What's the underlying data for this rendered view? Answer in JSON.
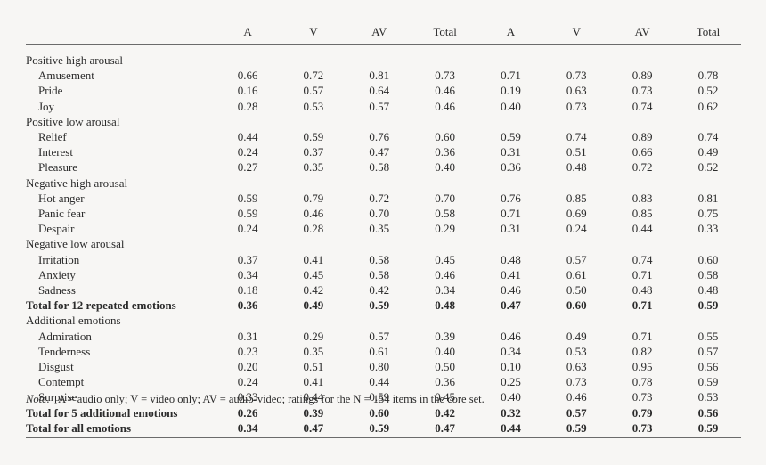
{
  "table": {
    "label_column_header": "",
    "column_headers": [
      "A",
      "V",
      "AV",
      "Total",
      "A",
      "V",
      "AV",
      "Total"
    ],
    "rows": [
      {
        "type": "group",
        "label": "Positive high arousal",
        "values": [
          "",
          "",
          "",
          "",
          "",
          "",
          "",
          ""
        ]
      },
      {
        "type": "emotion",
        "label": "Amusement",
        "values": [
          "0.66",
          "0.72",
          "0.81",
          "0.73",
          "0.71",
          "0.73",
          "0.89",
          "0.78"
        ]
      },
      {
        "type": "emotion",
        "label": "Pride",
        "values": [
          "0.16",
          "0.57",
          "0.64",
          "0.46",
          "0.19",
          "0.63",
          "0.73",
          "0.52"
        ]
      },
      {
        "type": "emotion",
        "label": "Joy",
        "values": [
          "0.28",
          "0.53",
          "0.57",
          "0.46",
          "0.40",
          "0.73",
          "0.74",
          "0.62"
        ]
      },
      {
        "type": "group",
        "label": "Positive low arousal",
        "values": [
          "",
          "",
          "",
          "",
          "",
          "",
          "",
          ""
        ]
      },
      {
        "type": "emotion",
        "label": "Relief",
        "values": [
          "0.44",
          "0.59",
          "0.76",
          "0.60",
          "0.59",
          "0.74",
          "0.89",
          "0.74"
        ]
      },
      {
        "type": "emotion",
        "label": "Interest",
        "values": [
          "0.24",
          "0.37",
          "0.47",
          "0.36",
          "0.31",
          "0.51",
          "0.66",
          "0.49"
        ]
      },
      {
        "type": "emotion",
        "label": "Pleasure",
        "values": [
          "0.27",
          "0.35",
          "0.58",
          "0.40",
          "0.36",
          "0.48",
          "0.72",
          "0.52"
        ]
      },
      {
        "type": "group",
        "label": "Negative high arousal",
        "values": [
          "",
          "",
          "",
          "",
          "",
          "",
          "",
          ""
        ]
      },
      {
        "type": "emotion",
        "label": "Hot anger",
        "values": [
          "0.59",
          "0.79",
          "0.72",
          "0.70",
          "0.76",
          "0.85",
          "0.83",
          "0.81"
        ]
      },
      {
        "type": "emotion",
        "label": "Panic fear",
        "values": [
          "0.59",
          "0.46",
          "0.70",
          "0.58",
          "0.71",
          "0.69",
          "0.85",
          "0.75"
        ]
      },
      {
        "type": "emotion",
        "label": "Despair",
        "values": [
          "0.24",
          "0.28",
          "0.35",
          "0.29",
          "0.31",
          "0.24",
          "0.44",
          "0.33"
        ]
      },
      {
        "type": "group",
        "label": "Negative low arousal",
        "values": [
          "",
          "",
          "",
          "",
          "",
          "",
          "",
          ""
        ]
      },
      {
        "type": "emotion",
        "label": "Irritation",
        "values": [
          "0.37",
          "0.41",
          "0.58",
          "0.45",
          "0.48",
          "0.57",
          "0.74",
          "0.60"
        ]
      },
      {
        "type": "emotion",
        "label": "Anxiety",
        "values": [
          "0.34",
          "0.45",
          "0.58",
          "0.46",
          "0.41",
          "0.61",
          "0.71",
          "0.58"
        ]
      },
      {
        "type": "emotion",
        "label": "Sadness",
        "values": [
          "0.18",
          "0.42",
          "0.42",
          "0.34",
          "0.46",
          "0.50",
          "0.48",
          "0.48"
        ]
      },
      {
        "type": "total",
        "label": "Total for 12 repeated emotions",
        "values": [
          "0.36",
          "0.49",
          "0.59",
          "0.48",
          "0.47",
          "0.60",
          "0.71",
          "0.59"
        ]
      },
      {
        "type": "group",
        "label": "Additional emotions",
        "values": [
          "",
          "",
          "",
          "",
          "",
          "",
          "",
          ""
        ]
      },
      {
        "type": "emotion",
        "label": "Admiration",
        "values": [
          "0.31",
          "0.29",
          "0.57",
          "0.39",
          "0.46",
          "0.49",
          "0.71",
          "0.55"
        ]
      },
      {
        "type": "emotion",
        "label": "Tenderness",
        "values": [
          "0.23",
          "0.35",
          "0.61",
          "0.40",
          "0.34",
          "0.53",
          "0.82",
          "0.57"
        ]
      },
      {
        "type": "emotion",
        "label": "Disgust",
        "values": [
          "0.20",
          "0.51",
          "0.80",
          "0.50",
          "0.10",
          "0.63",
          "0.95",
          "0.56"
        ]
      },
      {
        "type": "emotion",
        "label": "Contempt",
        "values": [
          "0.24",
          "0.41",
          "0.44",
          "0.36",
          "0.25",
          "0.73",
          "0.78",
          "0.59"
        ]
      },
      {
        "type": "emotion",
        "label": "Surprise",
        "values": [
          "0.33",
          "0.44",
          "0.59",
          "0.45",
          "0.40",
          "0.46",
          "0.73",
          "0.53"
        ]
      },
      {
        "type": "total",
        "label": "Total for 5 additional emotions",
        "values": [
          "0.26",
          "0.39",
          "0.60",
          "0.42",
          "0.32",
          "0.57",
          "0.79",
          "0.56"
        ]
      },
      {
        "type": "total",
        "label": "Total for all emotions",
        "values": [
          "0.34",
          "0.47",
          "0.59",
          "0.47",
          "0.44",
          "0.59",
          "0.73",
          "0.59"
        ]
      }
    ]
  },
  "note": {
    "prefix": "Note.",
    "text": "A = audio only; V = video only; AV = audio-video; ratings for the N = 154 items in the core set."
  }
}
